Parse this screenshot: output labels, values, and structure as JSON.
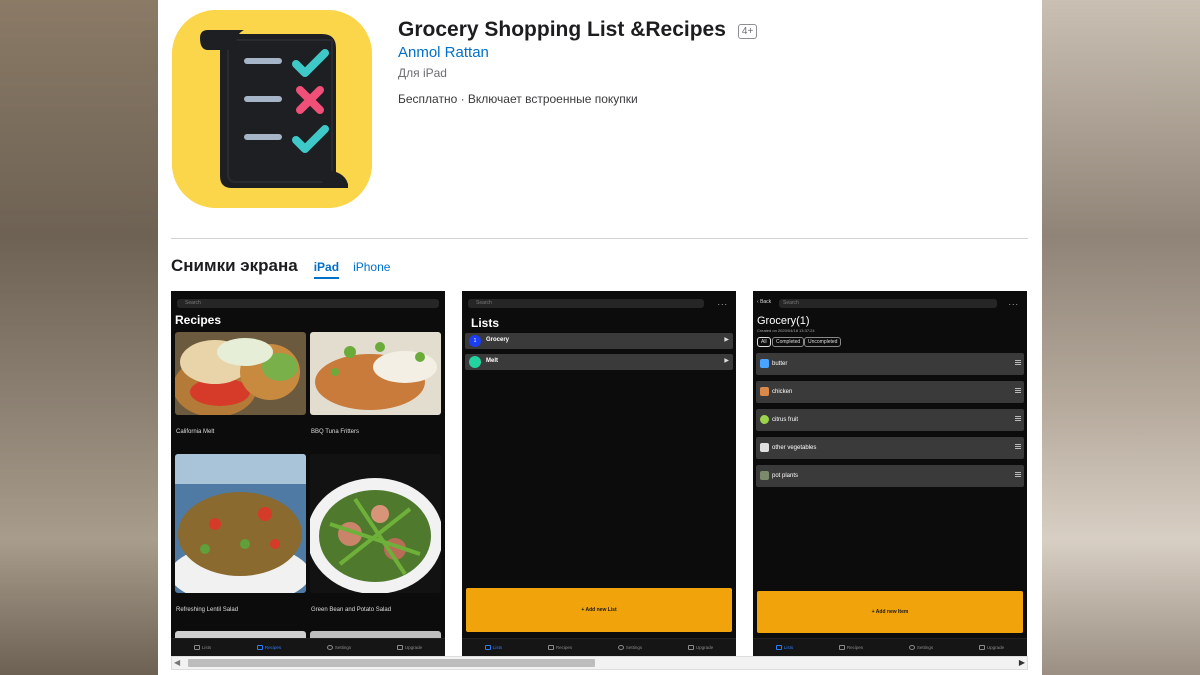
{
  "app": {
    "title": "Grocery Shopping List &Recipes",
    "age_rating": "4+",
    "developer": "Anmol Rattan",
    "platform": "Для iPad",
    "price_info": "Бесплатно · Включает встроенные покупки",
    "icon_name": "checklist-scroll-icon",
    "icon_bg_color": "#fbd64b"
  },
  "screenshots_section": {
    "title": "Снимки экрана",
    "tabs": [
      {
        "label": "iPad",
        "active": true
      },
      {
        "label": "iPhone",
        "active": false
      }
    ]
  },
  "screenshot1": {
    "search_placeholder": "Search",
    "heading": "Recipes",
    "recipes": [
      {
        "name": "California Melt"
      },
      {
        "name": "BBQ Tuna Fritters"
      },
      {
        "name": "Refreshing Lentil Salad"
      },
      {
        "name": "Green Bean and Potato Salad"
      }
    ],
    "tabbar": [
      {
        "label": "Lists",
        "active": false
      },
      {
        "label": "Recipes",
        "active": true
      },
      {
        "label": "Settings",
        "active": false
      },
      {
        "label": "Upgrade",
        "active": false
      }
    ]
  },
  "screenshot2": {
    "search_placeholder": "Search",
    "more": "...",
    "heading": "Lists",
    "lists": [
      {
        "name": "Grocery",
        "badge": "1",
        "color": "#1b3ef5"
      },
      {
        "name": "Melt",
        "badge": "",
        "color": "#22d3a0"
      }
    ],
    "add_button": "+ Add new List",
    "tabbar": [
      {
        "label": "Lists",
        "active": true
      },
      {
        "label": "Recipes",
        "active": false
      },
      {
        "label": "Settings",
        "active": false
      },
      {
        "label": "Upgrade",
        "active": false
      }
    ]
  },
  "screenshot3": {
    "back_label": "Back",
    "search_placeholder": "Search",
    "more": "...",
    "heading": "Grocery(1)",
    "created": "Created on 2020/04/18 13:37:24",
    "filters": [
      "All",
      "Completed",
      "Uncompleted"
    ],
    "items": [
      {
        "name": "butter",
        "icon": "butter-icon",
        "color": "#4aa3ff"
      },
      {
        "name": "chicken",
        "icon": "chicken-icon",
        "color": "#d98a4a"
      },
      {
        "name": "citrus fruit",
        "icon": "citrus-icon",
        "color": "#9bd34a"
      },
      {
        "name": "other vegetables",
        "icon": "vegetables-icon",
        "color": "#e0e0e0"
      },
      {
        "name": "pot plants",
        "icon": "plant-icon",
        "color": "#7a8a6a"
      }
    ],
    "add_button": "+ Add new Item",
    "tabbar": [
      {
        "label": "Lists",
        "active": true
      },
      {
        "label": "Recipes",
        "active": false
      },
      {
        "label": "Settings",
        "active": false
      },
      {
        "label": "Upgrade",
        "active": false
      }
    ]
  },
  "scrollbar": {
    "left_arrow": "◀",
    "right_arrow": "▶"
  }
}
